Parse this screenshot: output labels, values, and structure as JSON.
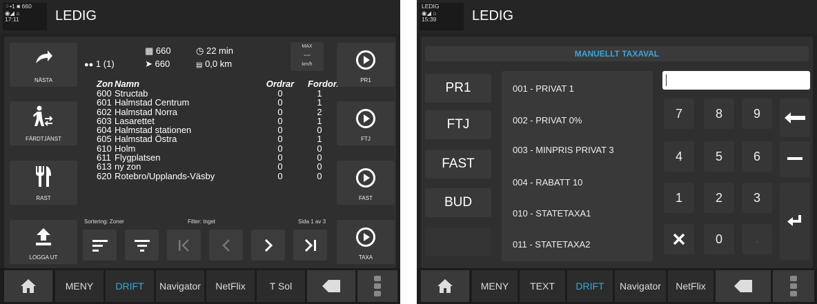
{
  "left": {
    "header": {
      "icons_line1": "⁘•1  ■ 660",
      "icons_line2": "◉◢  ⌂",
      "time": "17:11",
      "status": "LEDIG"
    },
    "side_buttons": [
      {
        "label": "NÄSTA",
        "icon": "redo-arrow-icon"
      },
      {
        "label": "FÄRDTJÄNST",
        "icon": "walking-person-icon"
      },
      {
        "label": "RAST",
        "icon": "fork-knife-icon"
      },
      {
        "label": "LOGGA UT",
        "icon": "upload-arrow-icon"
      }
    ],
    "info": {
      "count": "1 (1)",
      "map_value": "660",
      "nav_value": "660",
      "time_value": "22 min",
      "distance": "0,0 km",
      "max_label": "MAX",
      "max_value": "---",
      "max_unit": "km/h"
    },
    "table": {
      "headers": [
        "Zon",
        "Namn",
        "Ordrar",
        "Fordon"
      ],
      "rows": [
        [
          "600",
          "Structab",
          "0",
          "1"
        ],
        [
          "601",
          "Halmstad Centrum",
          "0",
          "1"
        ],
        [
          "602",
          "Halmstad Norra",
          "0",
          "2"
        ],
        [
          "603",
          "Lasarettet",
          "0",
          "1"
        ],
        [
          "604",
          "Halmstad stationen",
          "0",
          "0"
        ],
        [
          "605",
          "Halmstad Östra",
          "0",
          "1"
        ],
        [
          "610",
          "Holm",
          "0",
          "0"
        ],
        [
          "611",
          "Flygplatsen",
          "0",
          "0"
        ],
        [
          "613",
          "ny zon",
          "0",
          "0"
        ],
        [
          "620",
          "Rotebro/Upplands-Väsby",
          "0",
          "0"
        ]
      ],
      "sort": "Sortering: Zoner",
      "filter": "Filter: Inget",
      "page": "Sida 1 av 3"
    },
    "right_buttons": [
      "PR1",
      "FTJ",
      "FAST",
      "TAXA"
    ],
    "nav": [
      "MENY",
      "DRIFT",
      "Navigator",
      "NetFlix",
      "T Sol"
    ]
  },
  "right": {
    "header": {
      "top": "LEDIG",
      "icons": "◉◢  ⌂",
      "time": "15:39",
      "status": "LEDIG"
    },
    "title": "MANUELLT TAXAVAL",
    "categories": [
      "PR1",
      "FTJ",
      "FAST",
      "BUD"
    ],
    "rates": [
      "001 - PRIVAT 1",
      "002 - PRIVAT 0%",
      "003 - MINPRIS PRIVAT 3",
      "004 - RABATT 10",
      "010 - STATETAXA1",
      "011 - STATETAXA2"
    ],
    "input_value": "",
    "keys": [
      "7",
      "8",
      "9",
      "4",
      "5",
      "6",
      "1",
      "2",
      "3",
      "0",
      ","
    ],
    "nav": [
      "MENY",
      "TEXT",
      "DRIFT",
      "Navigator",
      "NetFlix"
    ]
  },
  "colors": {
    "accent": "#3aa6d8",
    "panel": "#2f2f2f",
    "button": "#3a3a3a"
  }
}
